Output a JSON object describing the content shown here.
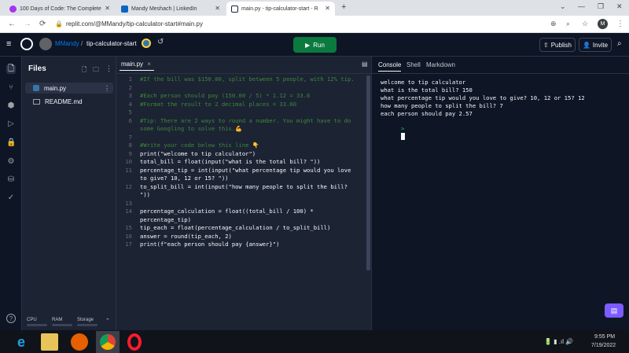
{
  "browser": {
    "tabs": [
      {
        "label": "100 Days of Code: The Complete",
        "favicon_color": "#a435f0"
      },
      {
        "label": "Mandy Meshach | LinkedIn",
        "favicon_color": "#0a66c2"
      },
      {
        "label": "main.py - tip-calculator-start - R",
        "favicon_color": "#1c2333"
      }
    ],
    "new_tab": "+",
    "url": "replit.com/@MMandy/tip-calculator-start#main.py",
    "profile_initial": "M"
  },
  "replit": {
    "username": "MMandy",
    "repl_name": "tip-calculator-start",
    "separator": "/",
    "run_label": "Run",
    "publish_label": "Publish",
    "invite_label": "Invite"
  },
  "files": {
    "title": "Files",
    "items": [
      {
        "name": "main.py",
        "icon": "python-icon"
      },
      {
        "name": "README.md",
        "icon": "markdown-icon"
      }
    ],
    "resources": {
      "cpu": "CPU",
      "ram": "RAM",
      "storage": "Storage"
    }
  },
  "editor": {
    "tab": "main.py",
    "lines": [
      {
        "n": "1",
        "text": "#If the bill was $150.00, split between 5 people, with 12% tip.",
        "comment": true
      },
      {
        "n": "2",
        "text": "",
        "comment": false
      },
      {
        "n": "3",
        "text": "#Each person should pay (150.00 / 5) * 1.12 = 33.6",
        "comment": true
      },
      {
        "n": "4",
        "text": "#Format the result to 2 decimal places = 33.60",
        "comment": true
      },
      {
        "n": "5",
        "text": "",
        "comment": false
      },
      {
        "n": "6",
        "text": "#Tip: There are 2 ways to round a number. You might have to do",
        "comment": true
      },
      {
        "n": "",
        "text": "some Googling to solve this.💪",
        "comment": true
      },
      {
        "n": "7",
        "text": "",
        "comment": false
      },
      {
        "n": "8",
        "text": "#Write your code below this line 👇",
        "comment": true
      },
      {
        "n": "9",
        "text": "print(\"welcome to tip calculator\")",
        "comment": false
      },
      {
        "n": "10",
        "text": "total_bill = float(input(\"what is the total bill? \"))",
        "comment": false
      },
      {
        "n": "11",
        "text": "percentage_tip = int(input(\"what percentage tip would you love",
        "comment": false
      },
      {
        "n": "",
        "text": "to give? 10, 12 or 15? \"))",
        "comment": false
      },
      {
        "n": "12",
        "text": "to_split_bill = int(input(\"how many people to split the bill?",
        "comment": false
      },
      {
        "n": "",
        "text": "\"))",
        "comment": false
      },
      {
        "n": "13",
        "text": "",
        "comment": false
      },
      {
        "n": "14",
        "text": "percentage_calculation = float((total_bill / 100) *",
        "comment": false
      },
      {
        "n": "",
        "text": "percentage_tip)",
        "comment": false
      },
      {
        "n": "15",
        "text": "tip_each = float(percentage_calculation / to_split_bill)",
        "comment": false
      },
      {
        "n": "16",
        "text": "answer = round(tip_each, 2)",
        "comment": false
      },
      {
        "n": "17",
        "text": "print(f\"each person should pay {answer}\")",
        "comment": false
      }
    ]
  },
  "console": {
    "tabs": [
      "Console",
      "Shell",
      "Markdown"
    ],
    "output": [
      "welcome to tip calculator",
      "what is the total bill? 150",
      "what percentage tip would you love to give? 10, 12 or 15? 12",
      "how many people to split the bill? 7",
      "each person should pay 2.57"
    ],
    "prompt": ">"
  },
  "taskbar": {
    "time": "9:55 PM",
    "date": "7/19/2022"
  }
}
